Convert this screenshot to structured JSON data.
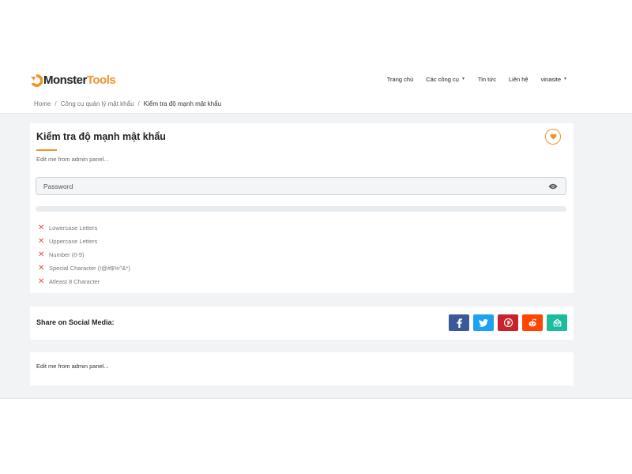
{
  "brand": {
    "name_main": "Monster",
    "name_accent": "Tools",
    "accent_color": "#f0932b"
  },
  "nav": {
    "items": [
      {
        "label": "Trang chủ",
        "dropdown": false
      },
      {
        "label": "Các công cụ",
        "dropdown": true
      },
      {
        "label": "Tin tức",
        "dropdown": false
      },
      {
        "label": "Liên hệ",
        "dropdown": false
      },
      {
        "label": "vinasite",
        "dropdown": true
      }
    ]
  },
  "breadcrumb": {
    "items": [
      "Home",
      "Công cụ quản lý mật khẩu"
    ],
    "active": "Kiểm tra độ mạnh mật khẩu"
  },
  "tool": {
    "title": "Kiểm tra độ mạnh mật khẩu",
    "subtitle": "Edit me from admin panel...",
    "password": {
      "value": "",
      "placeholder": "Password"
    },
    "strength_fraction": 0,
    "checks": [
      {
        "label": "Lowercase Letters",
        "passed": false
      },
      {
        "label": "Uppercase Letters",
        "passed": false
      },
      {
        "label": "Number (0-9)",
        "passed": false
      },
      {
        "label": "Special Character (!@#$%^&*)",
        "passed": false
      },
      {
        "label": "Atleast 8 Character",
        "passed": false
      }
    ]
  },
  "share": {
    "label": "Share on Social Media:",
    "buttons": [
      {
        "name": "facebook",
        "icon": "facebook-icon",
        "color": "#3b5998"
      },
      {
        "name": "twitter",
        "icon": "twitter-icon",
        "color": "#1da1f2"
      },
      {
        "name": "pinterest",
        "icon": "pinterest-icon",
        "color": "#c8232c"
      },
      {
        "name": "reddit",
        "icon": "reddit-icon",
        "color": "#ff4500"
      },
      {
        "name": "email",
        "icon": "mail-icon",
        "color": "#1abc9c"
      }
    ]
  },
  "note": {
    "text": "Edit me from admin panel..."
  }
}
